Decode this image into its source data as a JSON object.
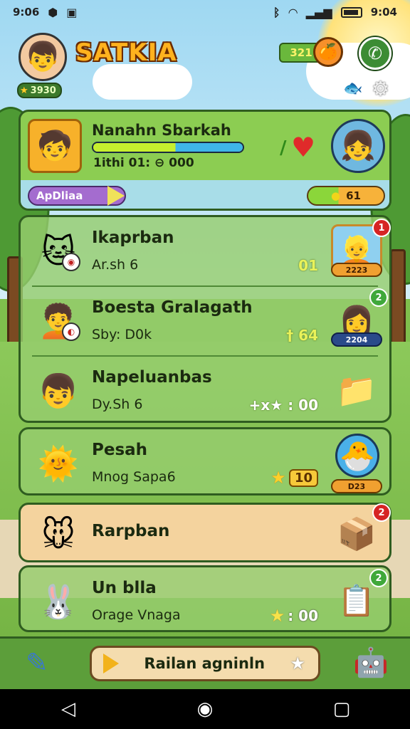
{
  "status_bar": {
    "time": "9:06",
    "clock_right": "9:04",
    "icons": [
      "shield-icon",
      "camera-icon",
      "bluetooth-icon",
      "wifi-icon",
      "signal-icon",
      "battery-icon"
    ]
  },
  "header": {
    "title": "SATKIA",
    "level_value": "3930",
    "coins": "321"
  },
  "profile": {
    "name": "Nanahn Sbarkah",
    "stats": "1ithi 01: ⊖ 000",
    "xp_progress": 0.55,
    "activity_label": "ApDliaa",
    "gems": "61"
  },
  "list_items": [
    {
      "title": "Ikaprban",
      "subtitle": "Ar.sh 6",
      "value": "01",
      "badge": "1",
      "badge_color": "red",
      "tag": "2223"
    },
    {
      "title": "Boesta Gralagath",
      "subtitle": "Sby: D0k",
      "value": "† 64",
      "badge": "2",
      "badge_color": "green",
      "tag": "2204"
    },
    {
      "title": "Napeluanbas",
      "subtitle": "Dy.Sh 6",
      "value": "+x★ : 00"
    },
    {
      "title": "Pesah",
      "subtitle": "Mnog Sapa6",
      "value": "10",
      "tag": "D23"
    },
    {
      "title": "Rarpban",
      "badge": "2",
      "badge_color": "red"
    },
    {
      "title": "Un blla",
      "subtitle": "Orage Vnaga",
      "value": ": 00",
      "badge": "2",
      "badge_color": "green"
    }
  ],
  "bottom_bar": {
    "cta_label": "Railan agninln"
  },
  "colors": {
    "accent_green": "#7dc24a",
    "title_orange": "#ffb21e",
    "heart_red": "#e02a2a"
  }
}
